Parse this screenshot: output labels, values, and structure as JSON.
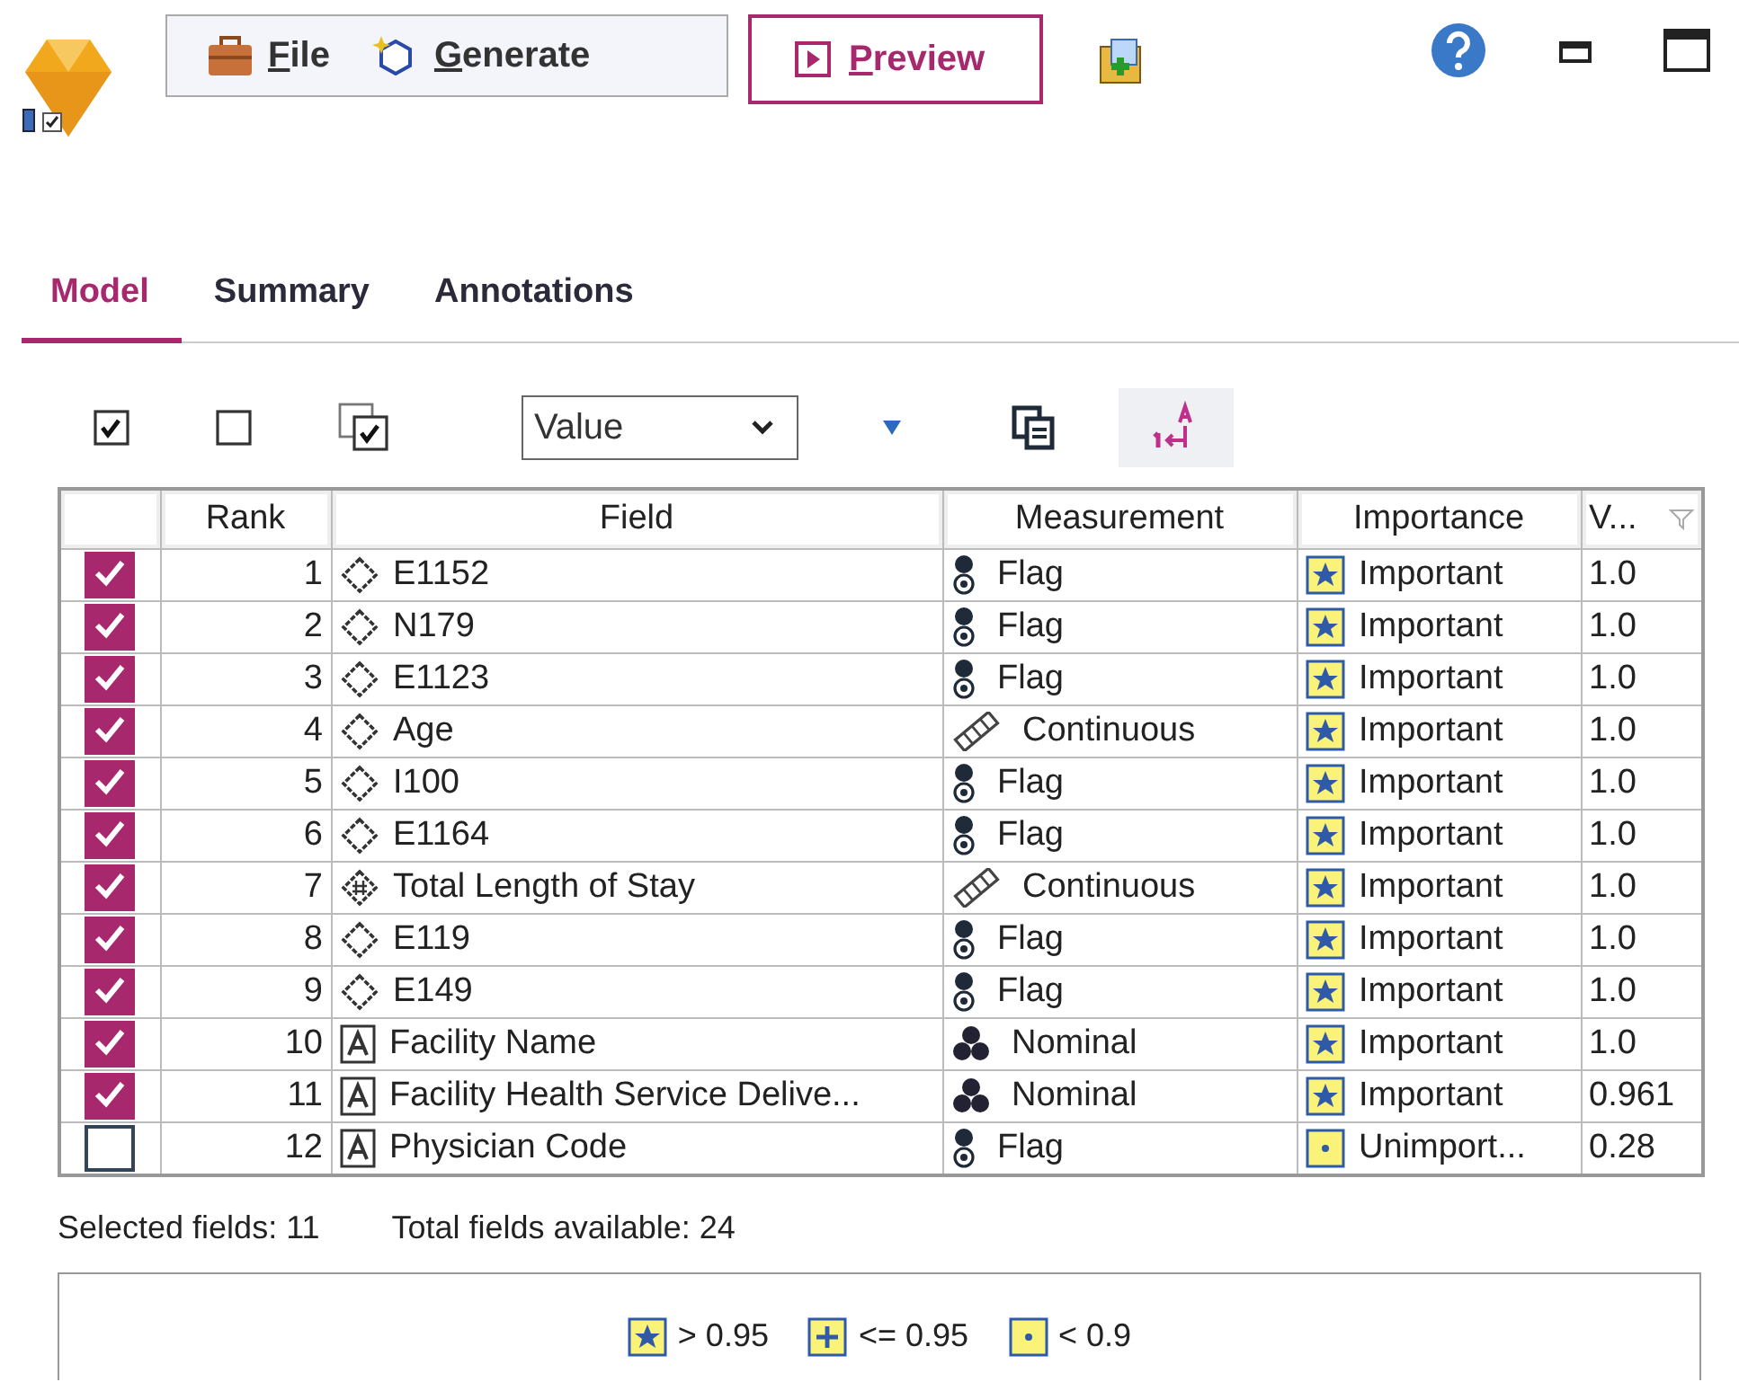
{
  "header": {
    "buttons": [
      {
        "kind": "file",
        "label": "File"
      },
      {
        "kind": "generate",
        "label": "Generate"
      }
    ],
    "preview": {
      "label": "Preview"
    }
  },
  "tabs": [
    {
      "label": "Model",
      "selected": true
    },
    {
      "label": "Summary",
      "selected": false
    },
    {
      "label": "Annotations",
      "selected": false
    }
  ],
  "toolbar": {
    "sort_select": {
      "value": "Value"
    }
  },
  "table": {
    "columns": [
      "Rank",
      "Field",
      "Measurement",
      "Importance",
      "V..."
    ],
    "rows": [
      {
        "checked": true,
        "rank": "1",
        "field": {
          "kind": "flag",
          "name": "E1152"
        },
        "measurement": {
          "kind": "flag",
          "label": "Flag"
        },
        "importance": {
          "kind": "important",
          "label": "Important"
        },
        "value": "1.0"
      },
      {
        "checked": true,
        "rank": "2",
        "field": {
          "kind": "flag",
          "name": "N179"
        },
        "measurement": {
          "kind": "flag",
          "label": "Flag"
        },
        "importance": {
          "kind": "important",
          "label": "Important"
        },
        "value": "1.0"
      },
      {
        "checked": true,
        "rank": "3",
        "field": {
          "kind": "flag",
          "name": "E1123"
        },
        "measurement": {
          "kind": "flag",
          "label": "Flag"
        },
        "importance": {
          "kind": "important",
          "label": "Important"
        },
        "value": "1.0"
      },
      {
        "checked": true,
        "rank": "4",
        "field": {
          "kind": "flag",
          "name": "Age"
        },
        "measurement": {
          "kind": "continuous",
          "label": "Continuous"
        },
        "importance": {
          "kind": "important",
          "label": "Important"
        },
        "value": "1.0"
      },
      {
        "checked": true,
        "rank": "5",
        "field": {
          "kind": "flag",
          "name": "I100"
        },
        "measurement": {
          "kind": "flag",
          "label": "Flag"
        },
        "importance": {
          "kind": "important",
          "label": "Important"
        },
        "value": "1.0"
      },
      {
        "checked": true,
        "rank": "6",
        "field": {
          "kind": "flag",
          "name": "E1164"
        },
        "measurement": {
          "kind": "flag",
          "label": "Flag"
        },
        "importance": {
          "kind": "important",
          "label": "Important"
        },
        "value": "1.0"
      },
      {
        "checked": true,
        "rank": "7",
        "field": {
          "kind": "numeric",
          "name": "Total Length of Stay"
        },
        "measurement": {
          "kind": "continuous",
          "label": "Continuous"
        },
        "importance": {
          "kind": "important",
          "label": "Important"
        },
        "value": "1.0"
      },
      {
        "checked": true,
        "rank": "8",
        "field": {
          "kind": "flag",
          "name": "E119"
        },
        "measurement": {
          "kind": "flag",
          "label": "Flag"
        },
        "importance": {
          "kind": "important",
          "label": "Important"
        },
        "value": "1.0"
      },
      {
        "checked": true,
        "rank": "9",
        "field": {
          "kind": "flag",
          "name": "E149"
        },
        "measurement": {
          "kind": "flag",
          "label": "Flag"
        },
        "importance": {
          "kind": "important",
          "label": "Important"
        },
        "value": "1.0"
      },
      {
        "checked": true,
        "rank": "10",
        "field": {
          "kind": "text",
          "name": "Facility Name"
        },
        "measurement": {
          "kind": "nominal",
          "label": "Nominal"
        },
        "importance": {
          "kind": "important",
          "label": "Important"
        },
        "value": "1.0"
      },
      {
        "checked": true,
        "rank": "11",
        "field": {
          "kind": "text",
          "name": "Facility Health Service Delive..."
        },
        "measurement": {
          "kind": "nominal",
          "label": "Nominal"
        },
        "importance": {
          "kind": "important",
          "label": "Important"
        },
        "value": "0.961"
      },
      {
        "checked": false,
        "rank": "12",
        "field": {
          "kind": "text",
          "name": "Physician Code"
        },
        "measurement": {
          "kind": "flag",
          "label": "Flag"
        },
        "importance": {
          "kind": "unimportant",
          "label": "Unimport..."
        },
        "value": "0.28"
      }
    ]
  },
  "status_bar": {
    "selected": "Selected fields: 11",
    "total": "Total fields available: 24"
  },
  "legend": [
    {
      "kind": "important",
      "label": "> 0.95"
    },
    {
      "kind": "marginal",
      "label": "<= 0.95"
    },
    {
      "kind": "unimportant",
      "label": "< 0.9"
    }
  ]
}
